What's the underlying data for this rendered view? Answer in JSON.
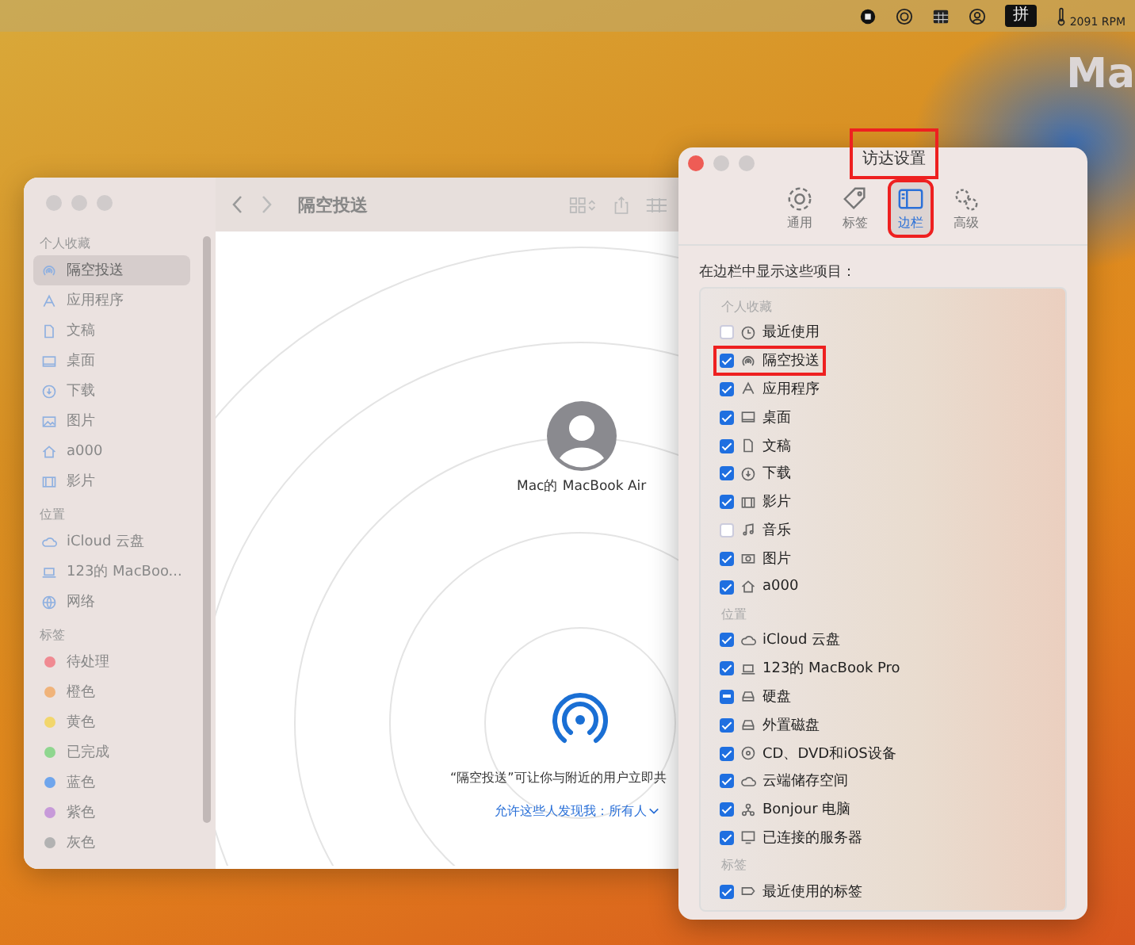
{
  "menubar": {
    "input_method": "拼",
    "fan_speed": "2091 RPM"
  },
  "desktop": {
    "corner_text": "Ma"
  },
  "finder": {
    "title": "隔空投送",
    "sidebar": [
      {
        "heading": "个人收藏",
        "items": [
          {
            "label": "隔空投送",
            "selected": true
          },
          {
            "label": "应用程序",
            "selected": false
          },
          {
            "label": "文稿",
            "selected": false
          },
          {
            "label": "桌面",
            "selected": false
          },
          {
            "label": "下载",
            "selected": false
          },
          {
            "label": "图片",
            "selected": false
          },
          {
            "label": "a000",
            "selected": false
          },
          {
            "label": "影片",
            "selected": false
          }
        ]
      },
      {
        "heading": "位置",
        "items": [
          {
            "label": "iCloud 云盘",
            "selected": false
          },
          {
            "label": "123的 MacBoo...",
            "selected": false
          },
          {
            "label": "网络",
            "selected": false
          }
        ]
      },
      {
        "heading": "标签",
        "items": [
          {
            "label": "待处理",
            "selected": false,
            "color": "#f08a92"
          },
          {
            "label": "橙色",
            "selected": false,
            "color": "#f0b37a"
          },
          {
            "label": "黄色",
            "selected": false,
            "color": "#f2d66c"
          },
          {
            "label": "已完成",
            "selected": false,
            "color": "#8fd68f"
          },
          {
            "label": "蓝色",
            "selected": false,
            "color": "#6fa5ec"
          },
          {
            "label": "紫色",
            "selected": false,
            "color": "#c79ad9"
          },
          {
            "label": "灰色",
            "selected": false,
            "color": "#b2b2b2"
          }
        ]
      }
    ],
    "device": "Mac的 MacBook Air",
    "description": "“隔空投送”可让你与附近的用户立即共",
    "discover_link": "允许这些人发现我：所有人"
  },
  "settings": {
    "title": "访达设置",
    "title_highlighted": true,
    "tabs": [
      {
        "label": "通用",
        "selected": false,
        "highlighted": false
      },
      {
        "label": "标签",
        "selected": false,
        "highlighted": false
      },
      {
        "label": "边栏",
        "selected": true,
        "highlighted": true
      },
      {
        "label": "高级",
        "selected": false,
        "highlighted": false
      }
    ],
    "prompt": "在边栏中显示这些项目：",
    "sections": [
      {
        "heading": "个人收藏",
        "items": [
          {
            "label": "最近使用",
            "checked": false,
            "mixed": false,
            "highlighted": false
          },
          {
            "label": "隔空投送",
            "checked": true,
            "mixed": false,
            "highlighted": true
          },
          {
            "label": "应用程序",
            "checked": true,
            "mixed": false,
            "highlighted": false
          },
          {
            "label": "桌面",
            "checked": true,
            "mixed": false,
            "highlighted": false
          },
          {
            "label": "文稿",
            "checked": true,
            "mixed": false,
            "highlighted": false
          },
          {
            "label": "下载",
            "checked": true,
            "mixed": false,
            "highlighted": false
          },
          {
            "label": "影片",
            "checked": true,
            "mixed": false,
            "highlighted": false
          },
          {
            "label": "音乐",
            "checked": false,
            "mixed": false,
            "highlighted": false
          },
          {
            "label": "图片",
            "checked": true,
            "mixed": false,
            "highlighted": false
          },
          {
            "label": "a000",
            "checked": true,
            "mixed": false,
            "highlighted": false
          }
        ]
      },
      {
        "heading": "位置",
        "items": [
          {
            "label": "iCloud 云盘",
            "checked": true,
            "mixed": false,
            "highlighted": false
          },
          {
            "label": "123的 MacBook Pro",
            "checked": true,
            "mixed": false,
            "highlighted": false
          },
          {
            "label": "硬盘",
            "checked": true,
            "mixed": true,
            "highlighted": false
          },
          {
            "label": "外置磁盘",
            "checked": true,
            "mixed": false,
            "highlighted": false
          },
          {
            "label": "CD、DVD和iOS设备",
            "checked": true,
            "mixed": false,
            "highlighted": false
          },
          {
            "label": "云端储存空间",
            "checked": true,
            "mixed": false,
            "highlighted": false
          },
          {
            "label": "Bonjour 电脑",
            "checked": true,
            "mixed": false,
            "highlighted": false
          },
          {
            "label": "已连接的服务器",
            "checked": true,
            "mixed": false,
            "highlighted": false
          }
        ]
      },
      {
        "heading": "标签",
        "items": [
          {
            "label": "最近使用的标签",
            "checked": true,
            "mixed": false,
            "highlighted": false
          }
        ]
      }
    ]
  }
}
